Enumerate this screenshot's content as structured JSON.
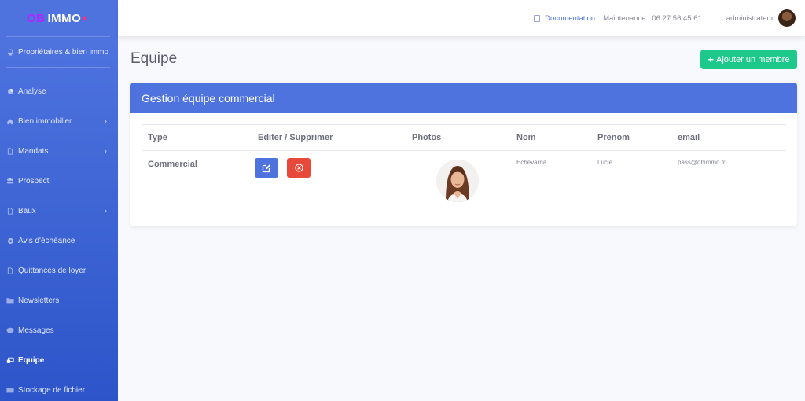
{
  "brand": {
    "part1": "OB",
    "part2": "IMMO",
    "mark": "●"
  },
  "sidebar": {
    "top_item": {
      "label": "Propriétaires & bien immo",
      "icon": "bell-icon"
    },
    "items": [
      {
        "label": "Analyse",
        "icon": "chart-pie-icon",
        "chevron": false
      },
      {
        "label": "Bien immobilier",
        "icon": "home-icon",
        "chevron": true
      },
      {
        "label": "Mandats",
        "icon": "file-icon",
        "chevron": true
      },
      {
        "label": "Prospect",
        "icon": "users-icon",
        "chevron": false
      },
      {
        "label": "Baux",
        "icon": "file-icon",
        "chevron": true
      },
      {
        "label": "Avis d'échéance",
        "icon": "circle-icon",
        "chevron": false
      },
      {
        "label": "Quittances de loyer",
        "icon": "file-icon",
        "chevron": false
      },
      {
        "label": "Newsletters",
        "icon": "folder-icon",
        "chevron": false
      },
      {
        "label": "Messages",
        "icon": "comment-icon",
        "chevron": false
      },
      {
        "label": "Equipe",
        "icon": "team-icon",
        "chevron": false,
        "active": true
      },
      {
        "label": "Stockage de fichier",
        "icon": "folder-icon",
        "chevron": false
      }
    ],
    "chevron_glyph": "›"
  },
  "topbar": {
    "documentation": "Documentation",
    "maintenance": "Maintenance : 06 27 56 45 61",
    "user": "administrateur"
  },
  "page": {
    "title": "Equipe",
    "add_button": "Ajouter un membre",
    "plus": "+"
  },
  "card": {
    "title": "Gestion équipe commercial",
    "columns": [
      "Type",
      "Editer / Supprimer",
      "Photos",
      "Nom",
      "Prenom",
      "email"
    ],
    "rows": [
      {
        "type": "Commercial",
        "nom": "Echevarria",
        "prenom": "Lucie",
        "email": "pass@obimmo.fr"
      }
    ]
  },
  "colors": {
    "primary": "#4e73df",
    "success": "#1cc88a",
    "danger": "#e74a3b",
    "brand_purple": "#b026ff"
  }
}
